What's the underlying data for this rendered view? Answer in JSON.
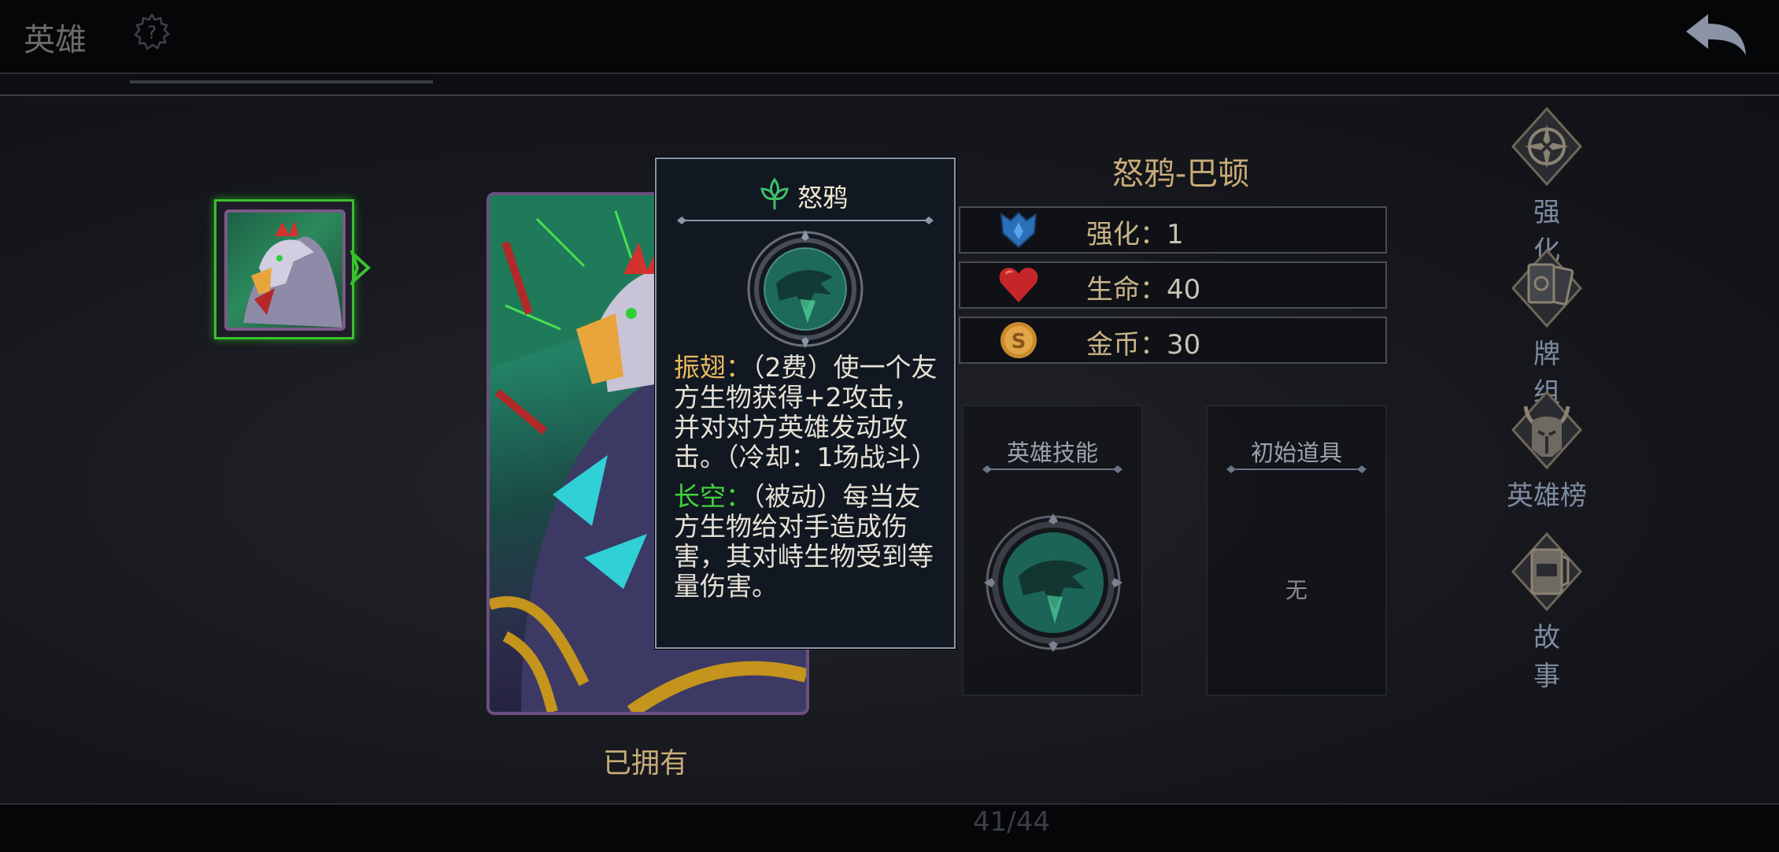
{
  "header": {
    "title": "英雄"
  },
  "hero_card": {
    "status_label": "已拥有"
  },
  "tooltip": {
    "name": "怒鸦",
    "skills": [
      {
        "name": "振翅：",
        "desc": "（2费）使一个友方生物获得+2攻击，并对对方英雄发动攻击。（冷却：1场战斗）"
      },
      {
        "name": "长空：",
        "desc": "（被动）每当友方生物给对手造成伤害，其对峙生物受到等量伤害。"
      }
    ]
  },
  "hero": {
    "full_name": "怒鸦-巴顿",
    "stats": [
      {
        "label": "强化：",
        "value": "1",
        "icon": "crest-icon"
      },
      {
        "label": "生命：",
        "value": "40",
        "icon": "heart-icon"
      },
      {
        "label": "金币：",
        "value": "30",
        "icon": "coin-icon"
      }
    ],
    "skill_box_title": "英雄技能",
    "item_box_title": "初始道具",
    "item_box_value": "无"
  },
  "nav": [
    {
      "label": "强化",
      "icon": "compass-icon"
    },
    {
      "label": "牌组",
      "icon": "cards-icon"
    },
    {
      "label": "英雄榜",
      "icon": "helmet-icon"
    },
    {
      "label": "故事",
      "icon": "book-icon"
    }
  ],
  "footer": {
    "page": "41/44"
  },
  "colors": {
    "accent_gold": "#c7ab78",
    "skill_gold": "#e7b860",
    "skill_green": "#3fd23a",
    "selected_border": "#3bbf2f"
  }
}
